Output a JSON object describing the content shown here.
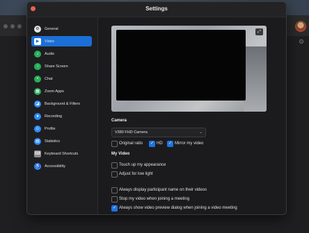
{
  "window": {
    "title": "Settings"
  },
  "sidebar": {
    "items": [
      {
        "label": "General",
        "icon": "gear-icon",
        "color": "#e5e5e5"
      },
      {
        "label": "Video",
        "icon": "video-icon",
        "color": "#ffffff",
        "active": true
      },
      {
        "label": "Audio",
        "icon": "headphones-icon",
        "color": "#26b05a"
      },
      {
        "label": "Share Screen",
        "icon": "share-screen-icon",
        "color": "#26b05a"
      },
      {
        "label": "Chat",
        "icon": "chat-icon",
        "color": "#26b05a"
      },
      {
        "label": "Zoom Apps",
        "icon": "apps-icon",
        "color": "#26b05a"
      },
      {
        "label": "Background & Filters",
        "icon": "background-icon",
        "color": "#2d8cff"
      },
      {
        "label": "Recording",
        "icon": "record-icon",
        "color": "#2d8cff"
      },
      {
        "label": "Profile",
        "icon": "profile-icon",
        "color": "#2d8cff"
      },
      {
        "label": "Statistics",
        "icon": "statistics-icon",
        "color": "#2d8cff"
      },
      {
        "label": "Keyboard Shortcuts",
        "icon": "keyboard-icon",
        "color": "#8a8a8f"
      },
      {
        "label": "Accessibility",
        "icon": "accessibility-icon",
        "color": "#2d8cff"
      }
    ]
  },
  "video": {
    "camera_heading": "Camera",
    "camera_selected": "V380 FHD Camera",
    "options": [
      {
        "label": "Original ratio",
        "checked": false
      },
      {
        "label": "HD",
        "checked": true
      },
      {
        "label": "Mirror my video",
        "checked": true
      }
    ],
    "my_video_heading": "My Video",
    "my_video": [
      {
        "label": "Touch up my appearance",
        "checked": false
      },
      {
        "label": "Adjust for low light",
        "checked": false
      }
    ],
    "meeting": [
      {
        "label": "Always display participant name on their videos",
        "checked": false
      },
      {
        "label": "Stop my video when joining a meeting",
        "checked": false
      },
      {
        "label": "Always show video preview dialog when joining a video meeting",
        "checked": true
      }
    ]
  }
}
